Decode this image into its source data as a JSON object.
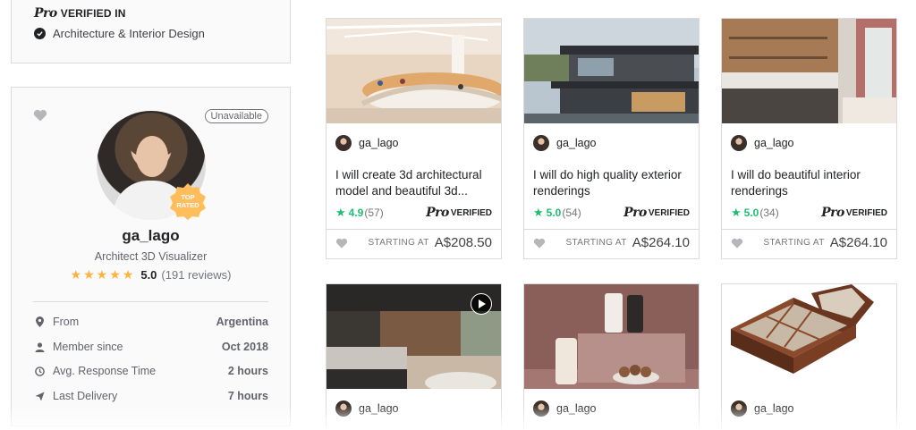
{
  "verified": {
    "pro_logo": "Pro",
    "label": "VERIFIED IN",
    "specialty": "Architecture & Interior Design"
  },
  "profile": {
    "status": "Unavailable",
    "badge_line1": "TOP",
    "badge_line2": "RATED",
    "username": "ga_lago",
    "tagline": "Architect 3D Visualizer",
    "stars": 5,
    "score": "5.0",
    "reviews": "(191 reviews)",
    "stats": [
      {
        "icon": "location-pin-icon",
        "label": "From",
        "value": "Argentina"
      },
      {
        "icon": "user-icon",
        "label": "Member since",
        "value": "Oct 2018"
      },
      {
        "icon": "clock-icon",
        "label": "Avg. Response Time",
        "value": "2 hours"
      },
      {
        "icon": "send-icon",
        "label": "Last Delivery",
        "value": "7 hours"
      }
    ]
  },
  "gigs": [
    {
      "seller": "ga_lago",
      "title": "I will create 3d architectural model and beautiful 3d...",
      "score": "4.9",
      "count": "(57)",
      "pro_logo": "Pro",
      "pro_label": "VERIFIED",
      "starting": "STARTING AT",
      "price": "A$208.50"
    },
    {
      "seller": "ga_lago",
      "title": "I will do high quality exterior renderings",
      "score": "5.0",
      "count": "(54)",
      "pro_logo": "Pro",
      "pro_label": "VERIFIED",
      "starting": "STARTING AT",
      "price": "A$264.10"
    },
    {
      "seller": "ga_lago",
      "title": "I will do beautiful interior renderings",
      "score": "5.0",
      "count": "(34)",
      "pro_logo": "Pro",
      "pro_label": "VERIFIED",
      "starting": "STARTING AT",
      "price": "A$264.10"
    },
    {
      "seller": "ga_lago"
    },
    {
      "seller": "ga_lago"
    },
    {
      "seller": "ga_lago"
    }
  ],
  "colors": {
    "accent_green": "#1dbf73",
    "star_yellow": "#ffb33e",
    "badge_yellow": "#ffbe5b",
    "border": "#dadbdd"
  }
}
